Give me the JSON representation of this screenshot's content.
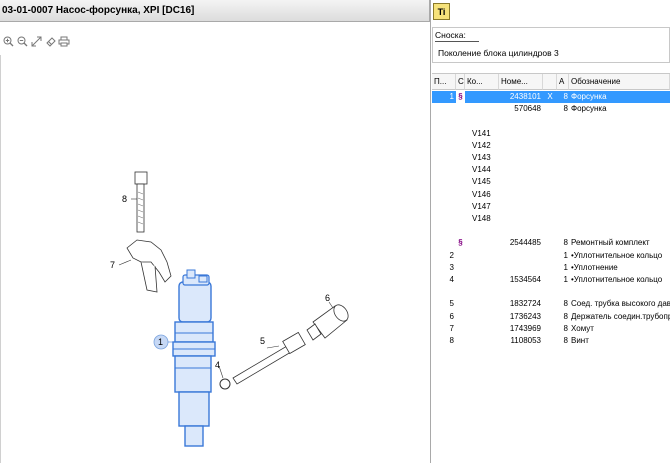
{
  "window": {
    "title": "03-01-0007 Насос-форсунка, XPI [DC16]"
  },
  "toolbar": {
    "icons": [
      "zoom-in-icon",
      "zoom-out-icon",
      "fit-icon",
      "eraser-icon",
      "print-icon"
    ]
  },
  "drawing": {
    "callouts": [
      "8",
      "7",
      "1",
      "4",
      "5",
      "6"
    ]
  },
  "side": {
    "ti_button": "Ti",
    "note_label": "Сноска:",
    "note_text": "Поколение блока цилиндров 3"
  },
  "table": {
    "headers": [
      "П...",
      "С",
      "Ко...",
      "Номе...",
      "",
      "А",
      "Обозначение"
    ],
    "rows": [
      {
        "pos": "1",
        "sect": "§",
        "code": "",
        "num": "2438101",
        "x": "X",
        "qty": "8",
        "name": "Форсунка",
        "selected": true
      },
      {
        "pos": "",
        "sect": "",
        "code": "",
        "num": "570648",
        "x": "",
        "qty": "8",
        "name": "Форсунка",
        "selected": false
      },
      {
        "pos": "",
        "sect": "",
        "code": "",
        "num": "",
        "x": "",
        "qty": "",
        "name": "",
        "selected": false
      },
      {
        "pos": "",
        "sect": "",
        "code": "V141",
        "num": "",
        "x": "",
        "qty": "",
        "name": "",
        "selected": false
      },
      {
        "pos": "",
        "sect": "",
        "code": "V142",
        "num": "",
        "x": "",
        "qty": "",
        "name": "",
        "selected": false
      },
      {
        "pos": "",
        "sect": "",
        "code": "V143",
        "num": "",
        "x": "",
        "qty": "",
        "name": "",
        "selected": false
      },
      {
        "pos": "",
        "sect": "",
        "code": "V144",
        "num": "",
        "x": "",
        "qty": "",
        "name": "",
        "selected": false
      },
      {
        "pos": "",
        "sect": "",
        "code": "V145",
        "num": "",
        "x": "",
        "qty": "",
        "name": "",
        "selected": false
      },
      {
        "pos": "",
        "sect": "",
        "code": "V146",
        "num": "",
        "x": "",
        "qty": "",
        "name": "",
        "selected": false
      },
      {
        "pos": "",
        "sect": "",
        "code": "V147",
        "num": "",
        "x": "",
        "qty": "",
        "name": "",
        "selected": false
      },
      {
        "pos": "",
        "sect": "",
        "code": "V148",
        "num": "",
        "x": "",
        "qty": "",
        "name": "",
        "selected": false
      },
      {
        "pos": "",
        "sect": "",
        "code": "",
        "num": "",
        "x": "",
        "qty": "",
        "name": "",
        "selected": false
      },
      {
        "pos": "",
        "sect": "§",
        "code": "",
        "num": "2544485",
        "x": "",
        "qty": "8",
        "name": "Ремонтный комплект",
        "selected": false
      },
      {
        "pos": "2",
        "sect": "",
        "code": "",
        "num": "",
        "x": "",
        "qty": "1",
        "name": "•Уплотнительное кольцо",
        "selected": false
      },
      {
        "pos": "3",
        "sect": "",
        "code": "",
        "num": "",
        "x": "",
        "qty": "1",
        "name": "•Уплотнение",
        "selected": false
      },
      {
        "pos": "4",
        "sect": "",
        "code": "",
        "num": "1534564",
        "x": "",
        "qty": "1",
        "name": "•Уплотнительное кольцо",
        "selected": false
      },
      {
        "pos": "",
        "sect": "",
        "code": "",
        "num": "",
        "x": "",
        "qty": "",
        "name": "",
        "selected": false
      },
      {
        "pos": "5",
        "sect": "",
        "code": "",
        "num": "1832724",
        "x": "",
        "qty": "8",
        "name": "Соед. трубка высокого давл",
        "selected": false
      },
      {
        "pos": "6",
        "sect": "",
        "code": "",
        "num": "1736243",
        "x": "",
        "qty": "8",
        "name": "Держатель соедин.трубопр",
        "selected": false
      },
      {
        "pos": "7",
        "sect": "",
        "code": "",
        "num": "1743969",
        "x": "",
        "qty": "8",
        "name": "Хомут",
        "selected": false
      },
      {
        "pos": "8",
        "sect": "",
        "code": "",
        "num": "1108053",
        "x": "",
        "qty": "8",
        "name": "Винт",
        "selected": false
      }
    ]
  }
}
